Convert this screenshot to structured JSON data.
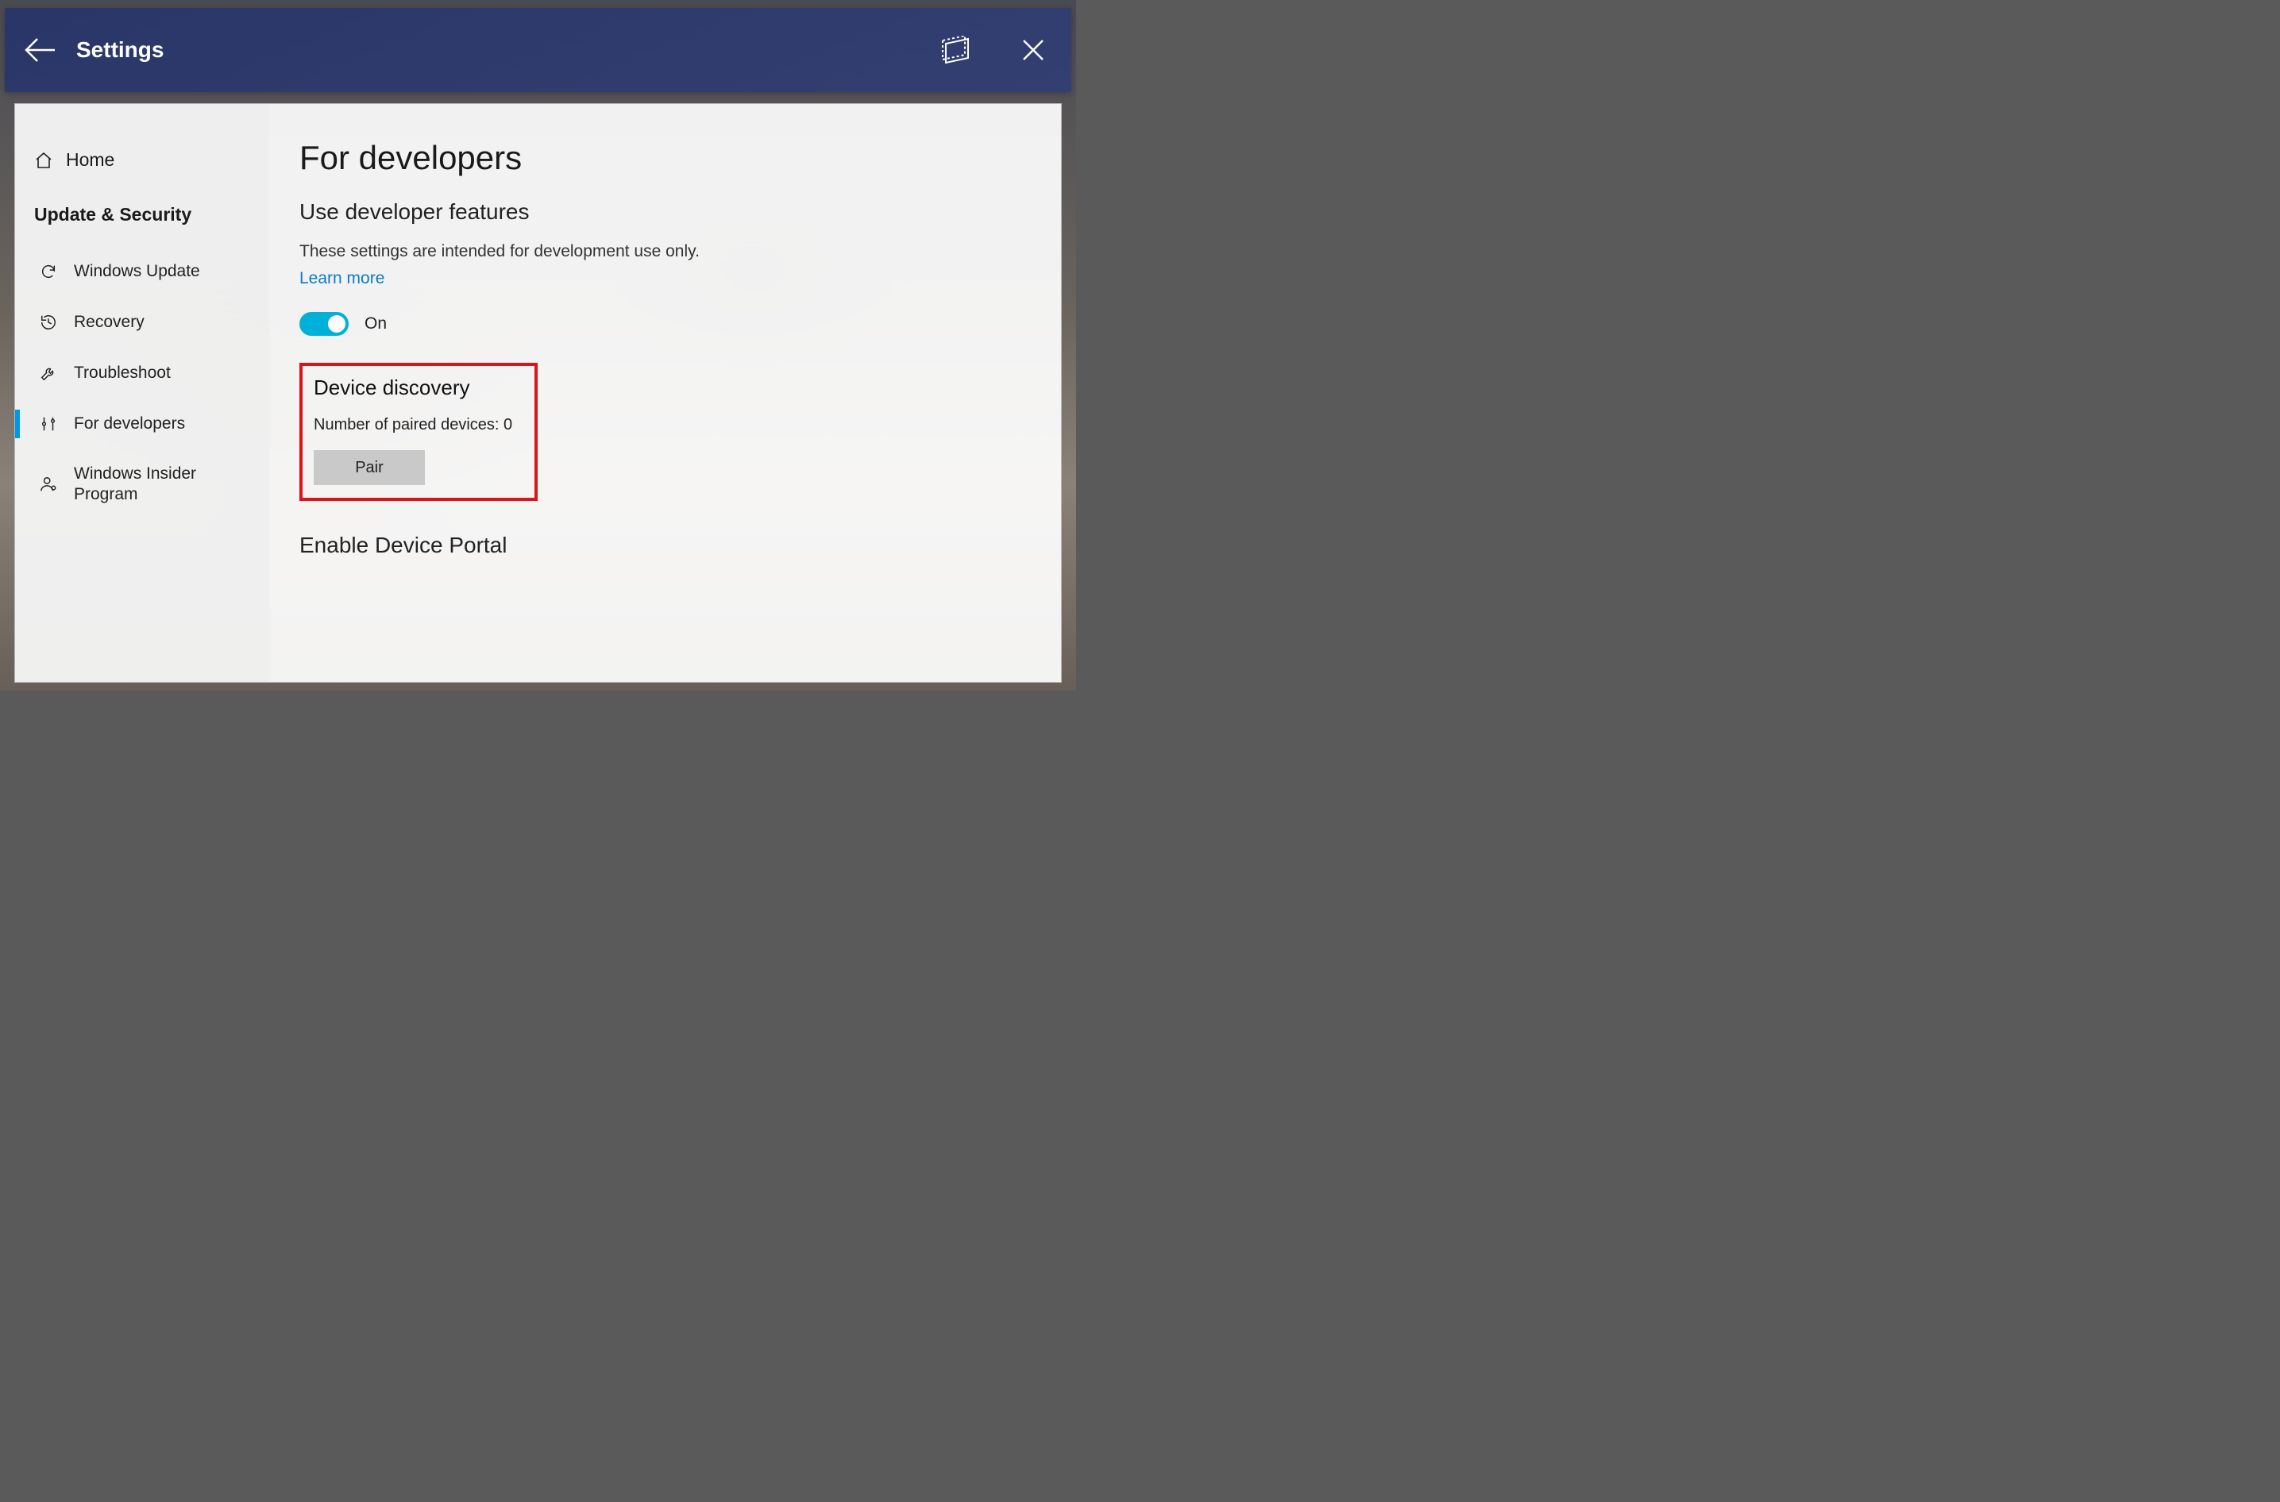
{
  "titlebar": {
    "title": "Settings"
  },
  "sidebar": {
    "home_label": "Home",
    "section_label": "Update & Security",
    "items": [
      {
        "label": "Windows Update"
      },
      {
        "label": "Recovery"
      },
      {
        "label": "Troubleshoot"
      },
      {
        "label": "For developers"
      },
      {
        "label": "Windows Insider Program"
      }
    ]
  },
  "main": {
    "heading": "For developers",
    "subheading": "Use developer features",
    "description": "These settings are intended for development use only.",
    "learn_more": "Learn more",
    "toggle_state_label": "On",
    "device_discovery": {
      "title": "Device discovery",
      "paired_label": "Number of paired devices: 0",
      "pair_button": "Pair"
    },
    "enable_device_portal": "Enable Device Portal"
  }
}
